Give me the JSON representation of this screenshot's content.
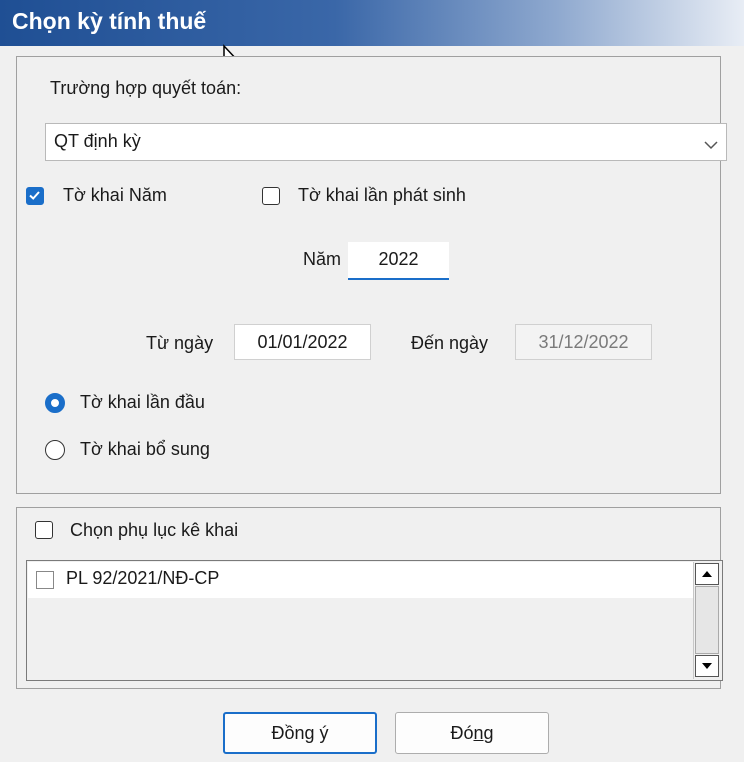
{
  "window": {
    "title": "Chọn kỳ tính thuế"
  },
  "case": {
    "label": "Trường hợp quyết toán:",
    "selected": "QT định kỳ"
  },
  "declaration_type": {
    "annual_label": "Tờ khai Năm",
    "annual_checked": true,
    "occasional_label": "Tờ khai lần phát sinh",
    "occasional_checked": false
  },
  "year": {
    "label": "Năm",
    "value": "2022"
  },
  "period": {
    "from_label": "Từ ngày",
    "from_value": "01/01/2022",
    "to_label": "Đến ngày",
    "to_value": "31/12/2022"
  },
  "submission": {
    "first_label": "Tờ khai lần đầu",
    "first_selected": true,
    "supplement_label": "Tờ khai bổ sung",
    "supplement_selected": false
  },
  "appendix": {
    "select_label": "Chọn phụ lục kê khai",
    "select_checked": false,
    "items": [
      {
        "label": "PL 92/2021/NĐ-CP",
        "checked": false
      }
    ]
  },
  "buttons": {
    "ok_prefix": "Đồn",
    "ok_mnemonic": "g",
    "ok_suffix": " ý",
    "close_prefix": "Đó",
    "close_mnemonic": "n",
    "close_suffix": "g"
  },
  "colors": {
    "accent": "#1a6ec9",
    "titlebar": "#1f4f94"
  },
  "icons": {
    "dropdown": "chevron-down-icon",
    "scroll_up": "triangle-up-icon",
    "scroll_down": "triangle-down-icon",
    "cursor": "mouse-pointer-icon"
  }
}
